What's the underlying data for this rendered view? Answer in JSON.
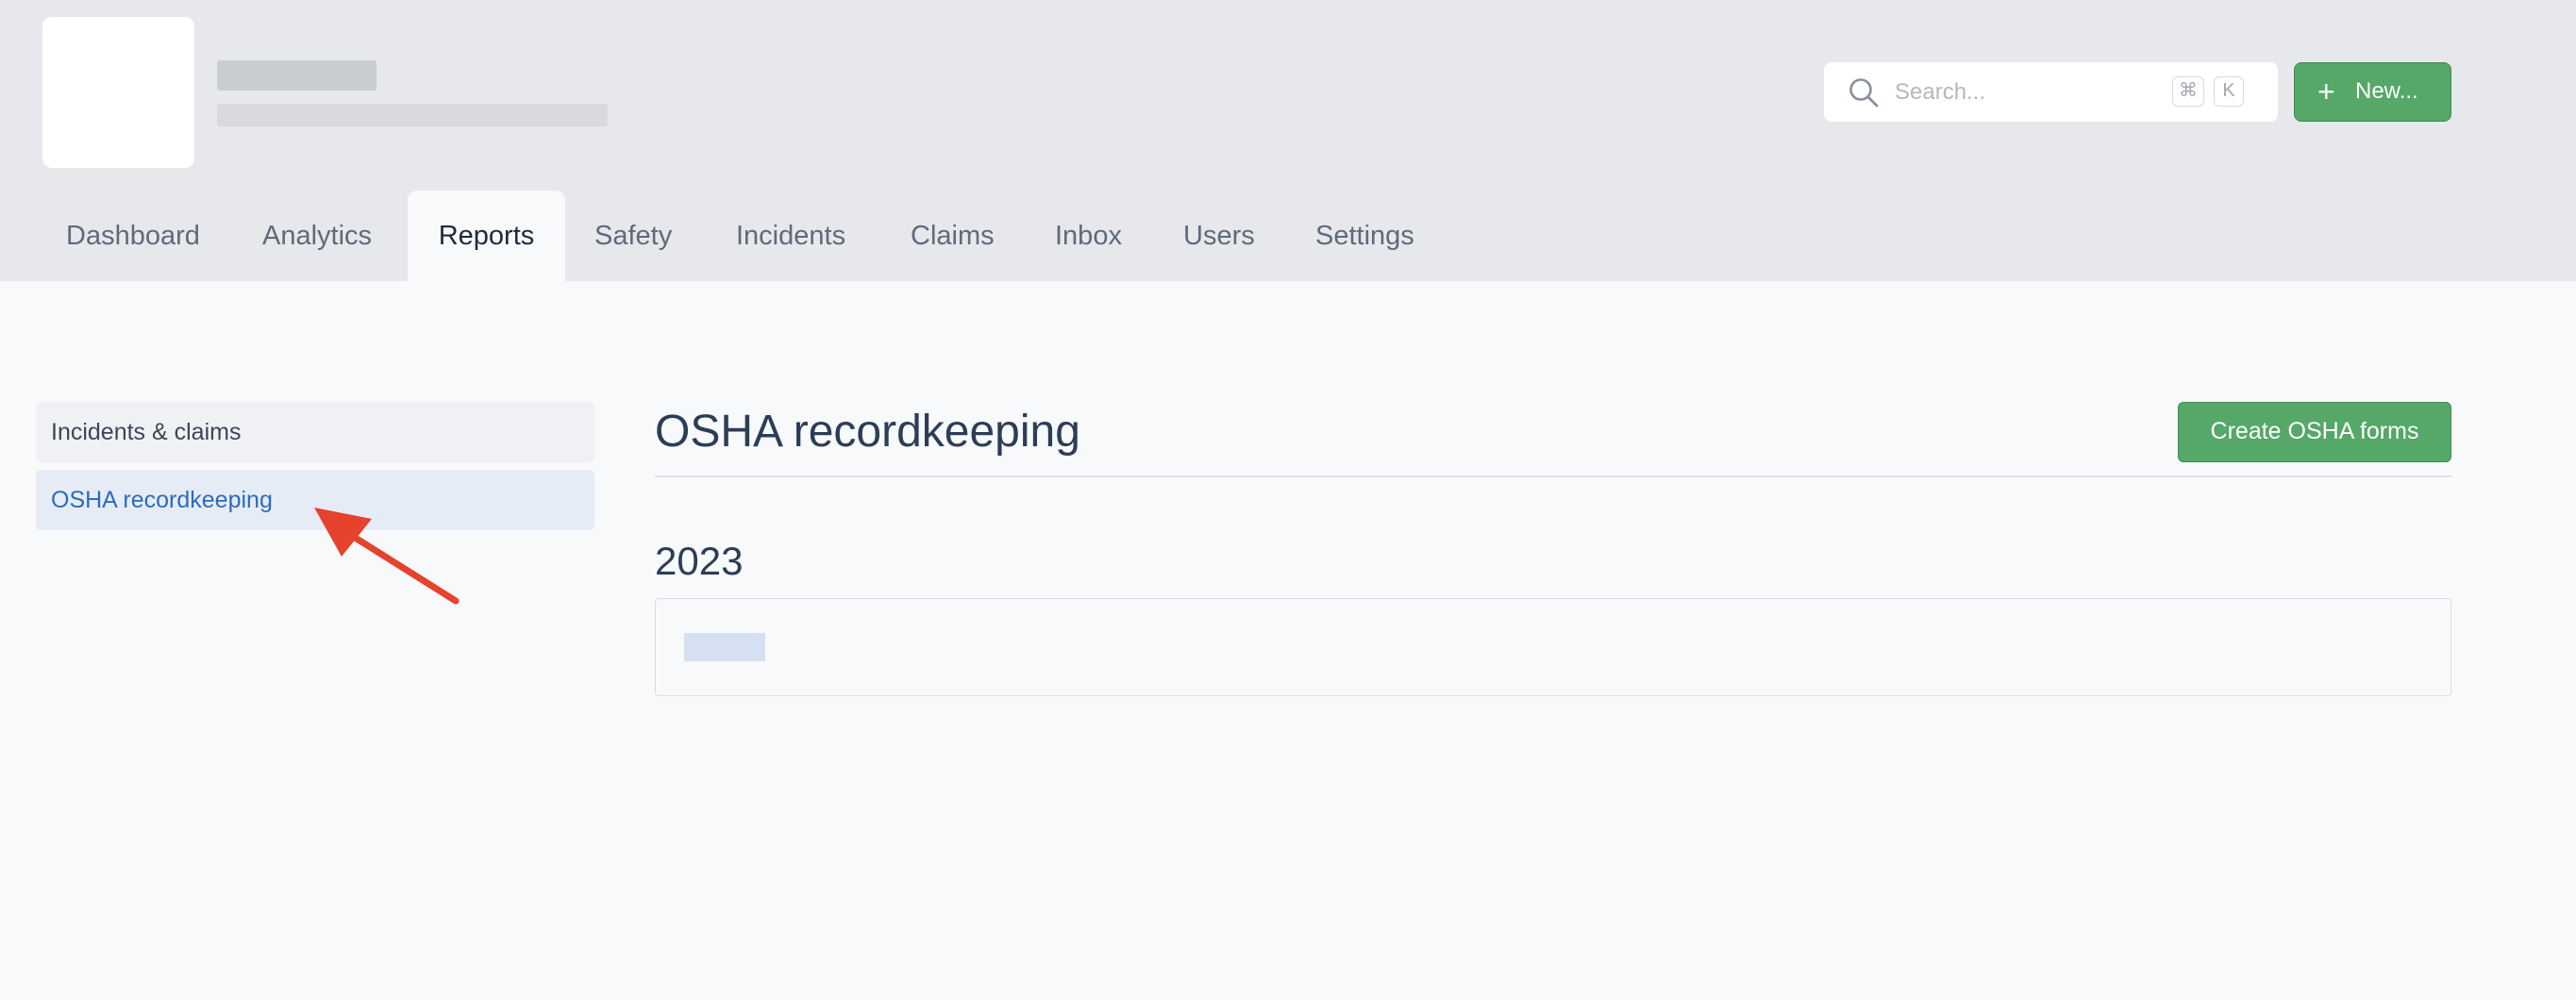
{
  "header": {
    "search": {
      "placeholder": "Search...",
      "shortcut_cmd": "⌘",
      "shortcut_key": "K"
    },
    "new_button": {
      "label": "New...",
      "icon": "plus-icon"
    }
  },
  "tabs": [
    {
      "label": "Dashboard"
    },
    {
      "label": "Analytics"
    },
    {
      "label": "Reports",
      "active": true
    },
    {
      "label": "Safety"
    },
    {
      "label": "Incidents"
    },
    {
      "label": "Claims"
    },
    {
      "label": "Inbox"
    },
    {
      "label": "Users"
    },
    {
      "label": "Settings"
    }
  ],
  "sidebar": {
    "items": [
      {
        "label": "Incidents & claims"
      },
      {
        "label": "OSHA recordkeeping",
        "selected": true
      }
    ]
  },
  "main": {
    "title": "OSHA recordkeeping",
    "create_button": "Create OSHA forms",
    "year": "2023"
  },
  "annotation": {
    "type": "arrow",
    "color": "#e5432d"
  },
  "colors": {
    "accent_green": "#55a868",
    "link_blue": "#2d6bbd"
  }
}
